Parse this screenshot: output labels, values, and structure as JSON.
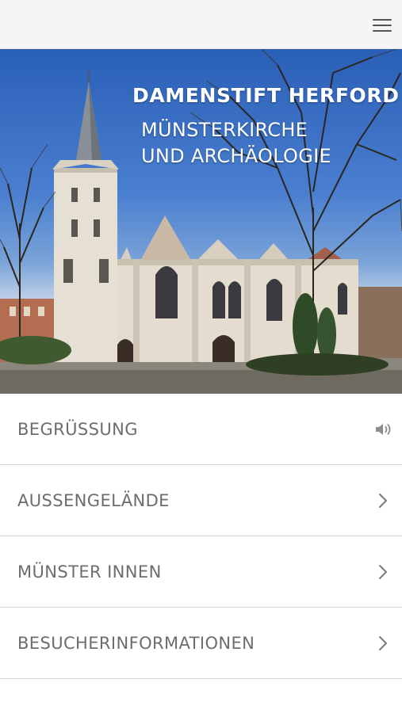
{
  "header": {
    "menu_icon": "hamburger-menu-icon"
  },
  "hero": {
    "title": "DAMENSTIFT HERFORD",
    "subtitle_line1": "MÜNSTERKIRCHE",
    "subtitle_line2": "UND ARCHÄOLOGIE",
    "image_subject": "church-photo"
  },
  "menu": {
    "items": [
      {
        "label": "BEGRÜSSUNG",
        "icon": "speaker-icon"
      },
      {
        "label": "AUSSENGELÄNDE",
        "icon": "chevron-right-icon"
      },
      {
        "label": "MÜNSTER INNEN",
        "icon": "chevron-right-icon"
      },
      {
        "label": "BESUCHERINFORMATIONEN",
        "icon": "chevron-right-icon"
      }
    ]
  },
  "colors": {
    "topbar_bg": "#f5f5f5",
    "text": "#6d6d6d",
    "divider": "#d6d6d6",
    "icon": "#888888"
  }
}
